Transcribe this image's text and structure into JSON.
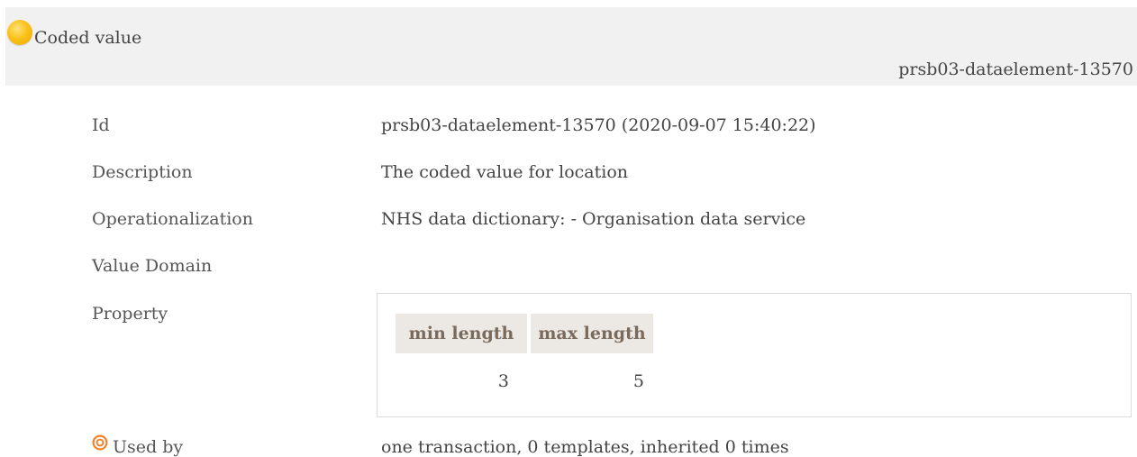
{
  "header": {
    "title": "Coded value",
    "identifier": "prsb03-dataelement-13570",
    "status_icon": "status-circle-icon",
    "status_color": "#fbc21b"
  },
  "rows": {
    "id": {
      "label": "Id",
      "value": "prsb03-dataelement-13570 (2020-09-07 15:40:22)"
    },
    "description": {
      "label": "Description",
      "value": "The coded value for location"
    },
    "operationalization": {
      "label": "Operationalization",
      "value": "NHS data dictionary: - Organisation data service"
    },
    "value_domain": {
      "label": "Value Domain",
      "value": ""
    },
    "property": {
      "label": "Property"
    },
    "used_by": {
      "label": "Used by",
      "value": "one transaction, 0 templates, inherited 0 times",
      "icon": "target-icon",
      "icon_color": "#f5822a"
    }
  },
  "property_table": {
    "headers": [
      "min length",
      "max length"
    ],
    "values": [
      "3",
      "5"
    ],
    "header_bg": "#ece8e3",
    "header_color": "#7a6a5c"
  }
}
